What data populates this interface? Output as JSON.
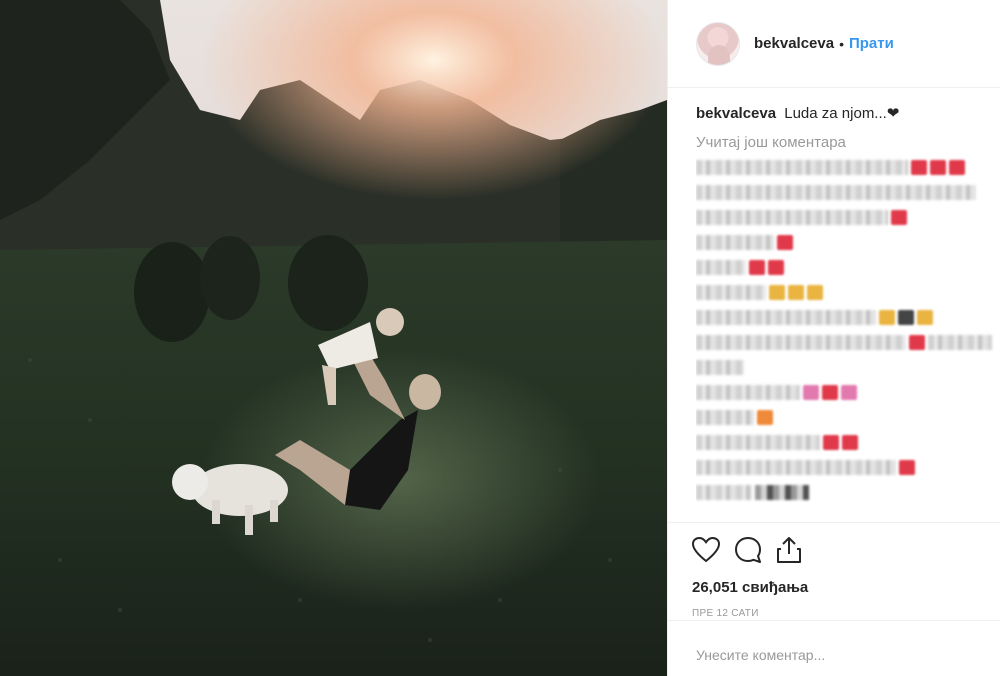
{
  "post": {
    "username": "bekvalceva",
    "separator": "•",
    "follow_label": "Прати",
    "caption_user": "bekvalceva",
    "caption_text": "Luda za njom...❤",
    "load_more_label": "Учитај још коментара",
    "likes": "26,051 свиђања",
    "time": "ПРЕ 12 САТИ",
    "comment_placeholder": "Унесите коментар..."
  },
  "icons": {
    "like": "heart-icon",
    "comment": "comment-bubble-icon",
    "share": "share-upload-icon"
  },
  "colors": {
    "link": "#3897f0",
    "text": "#262626",
    "muted": "#999999",
    "border": "#efefef"
  }
}
